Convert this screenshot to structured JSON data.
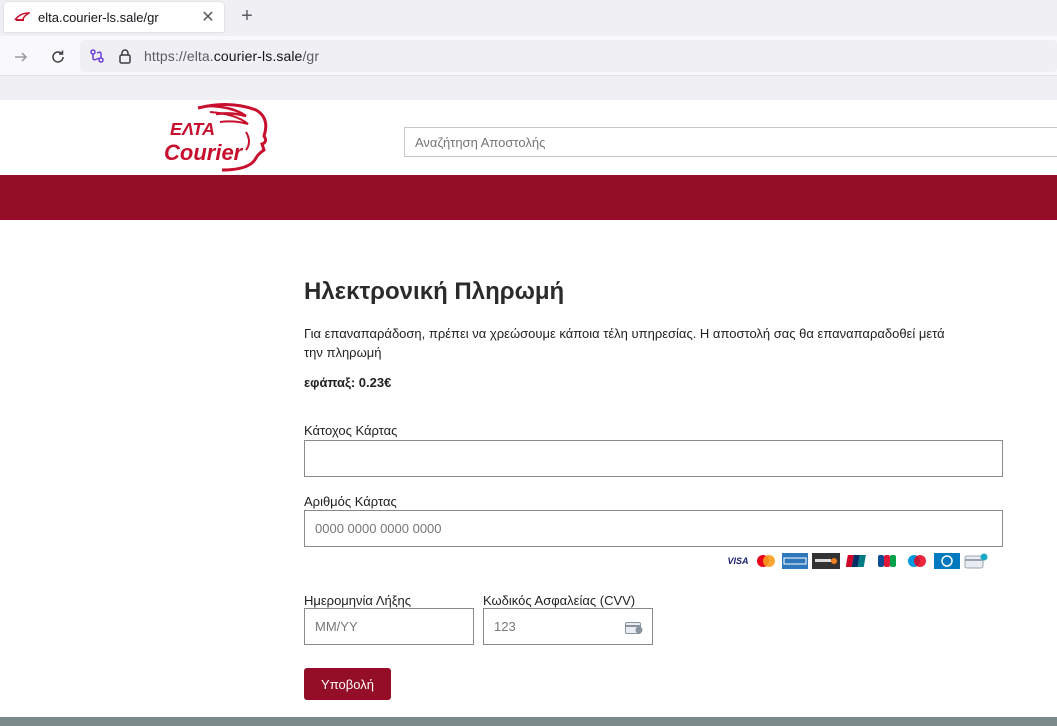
{
  "browser": {
    "tab_title": "elta.courier-ls.sale/gr",
    "tab_close": "✕",
    "new_tab": "+",
    "url_prefix": "https://elta.",
    "url_domain": "courier-ls.sale",
    "url_suffix": "/gr"
  },
  "header": {
    "logo_line1": "ΕΛΤΑ",
    "logo_line2": "Courier",
    "search_placeholder": "Αναζήτηση Αποστολής",
    "brand_color": "#950e27"
  },
  "payment": {
    "title": "Ηλεκτρονική Πληρωμή",
    "intro": "Για επαναπαράδοση, πρέπει να χρεώσουμε κάποια τέλη υπηρεσίας. Η αποστολή σας θα επαναπαραδοθεί μετά την πληρωμή",
    "fee": "εφάπαξ: 0.23€",
    "cardholder_label": "Κάτοχος Κάρτας",
    "cardholder_value": "",
    "card_number_label": "Αριθμός Κάρτας",
    "card_number_placeholder": "0000 0000 0000 0000",
    "expiry_label": "Ημερομηνία Λήξης",
    "expiry_placeholder": "MM/YY",
    "cvv_label": "Κωδικός Ασφαλείας (CVV)",
    "cvv_placeholder": "123",
    "submit_label": "Υποβολή",
    "card_brands": [
      "VISA",
      "mastercard",
      "amex",
      "discover",
      "unionpay",
      "jcb",
      "maestro",
      "diners",
      "generic-card"
    ]
  }
}
